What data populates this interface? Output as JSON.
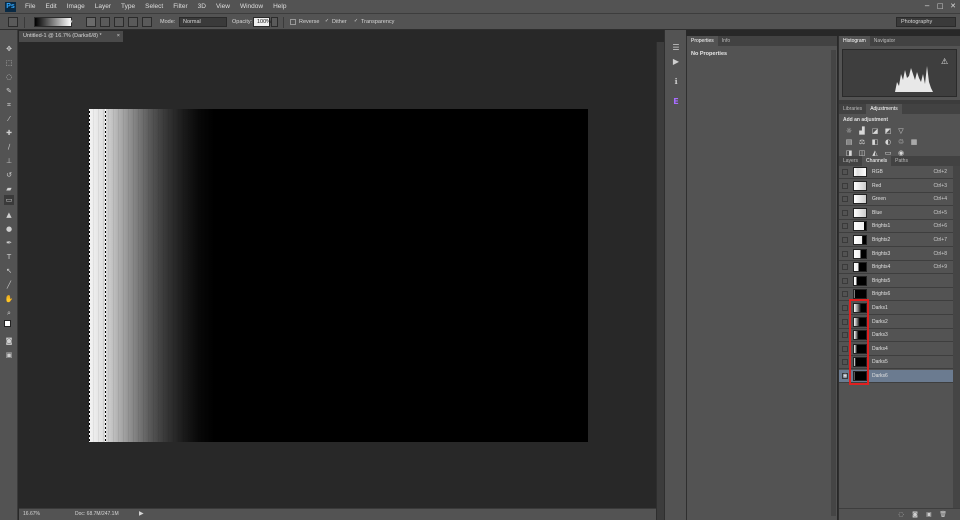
{
  "app": {
    "logo": "Ps"
  },
  "menu": [
    "File",
    "Edit",
    "Image",
    "Layer",
    "Type",
    "Select",
    "Filter",
    "3D",
    "View",
    "Window",
    "Help"
  ],
  "window_controls": [
    "−",
    "□",
    "✕"
  ],
  "options": {
    "mode_label": "Mode:",
    "mode_value": "Normal",
    "opacity_label": "Opacity:",
    "opacity_value": "100%",
    "reverse_label": "Reverse",
    "dither_label": "Dither",
    "transparency_label": "Transparency",
    "reverse_checked": false,
    "dither_checked": true,
    "transparency_checked": true
  },
  "workspace_select": "Photography",
  "document": {
    "tab_title": "Untitled-1 @ 16.7% (Darks6/8) *",
    "close": "×"
  },
  "status": {
    "zoom": "16.67%",
    "doc_info": "Doc: 68.7M/247.1M"
  },
  "properties_panel": {
    "tabs": [
      "Properties",
      "Info"
    ],
    "title": "No Properties"
  },
  "histogram_panel": {
    "tabs": [
      "Histogram",
      "Navigator"
    ]
  },
  "adjustments_panel": {
    "tabs": [
      "Libraries",
      "Adjustments"
    ],
    "title": "Add an adjustment"
  },
  "channels_panel": {
    "tabs": [
      "Layers",
      "Channels",
      "Paths"
    ],
    "rows": [
      {
        "name": "RGB",
        "shortcut": "Ctrl+2",
        "visible": false,
        "selected": false
      },
      {
        "name": "Red",
        "shortcut": "Ctrl+3",
        "visible": false,
        "selected": false
      },
      {
        "name": "Green",
        "shortcut": "Ctrl+4",
        "visible": false,
        "selected": false
      },
      {
        "name": "Blue",
        "shortcut": "Ctrl+5",
        "visible": false,
        "selected": false
      },
      {
        "name": "Brights1",
        "shortcut": "Ctrl+6",
        "visible": false,
        "selected": false
      },
      {
        "name": "Brights2",
        "shortcut": "Ctrl+7",
        "visible": false,
        "selected": false
      },
      {
        "name": "Brights3",
        "shortcut": "Ctrl+8",
        "visible": false,
        "selected": false
      },
      {
        "name": "Brights4",
        "shortcut": "Ctrl+9",
        "visible": false,
        "selected": false
      },
      {
        "name": "Brights5",
        "shortcut": "",
        "visible": false,
        "selected": false
      },
      {
        "name": "Brights6",
        "shortcut": "",
        "visible": false,
        "selected": false
      },
      {
        "name": "Darks1",
        "shortcut": "",
        "visible": false,
        "selected": false
      },
      {
        "name": "Darks2",
        "shortcut": "",
        "visible": false,
        "selected": false
      },
      {
        "name": "Darks3",
        "shortcut": "",
        "visible": false,
        "selected": false
      },
      {
        "name": "Darks4",
        "shortcut": "",
        "visible": false,
        "selected": false
      },
      {
        "name": "Darks5",
        "shortcut": "",
        "visible": false,
        "selected": false
      },
      {
        "name": "Darks6",
        "shortcut": "",
        "visible": true,
        "selected": true
      }
    ]
  },
  "colors": {
    "highlight": "#e02020",
    "selected_row": "#6b7b90",
    "ps_blue": "#31a8ff"
  }
}
